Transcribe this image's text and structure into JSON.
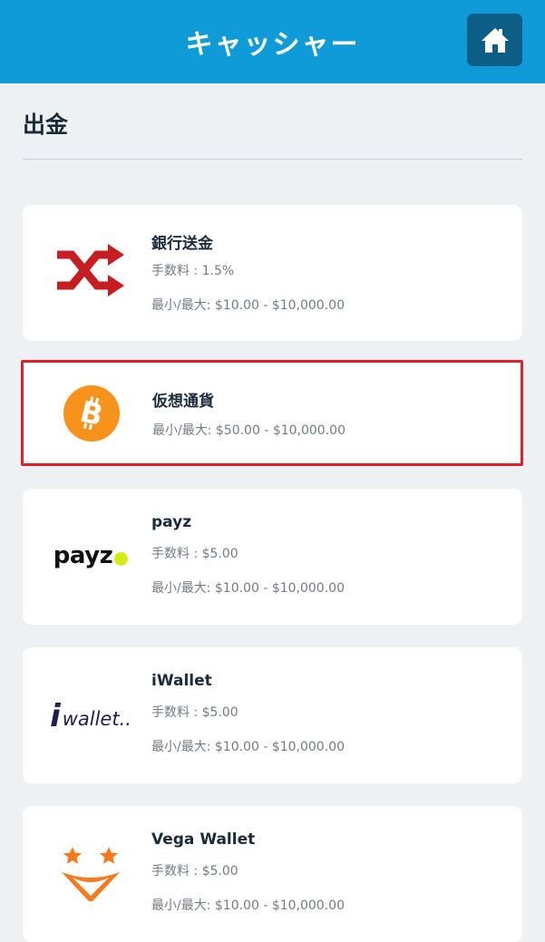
{
  "header": {
    "title": "キャッシャー"
  },
  "section": {
    "title": "出金"
  },
  "methods": [
    {
      "name": "銀行送金",
      "fee": "手数料 : 1.5%",
      "limits": "最小/最大: $10.00 - $10,000.00",
      "icon": "bank-transfer-shuffle-icon"
    },
    {
      "name": "仮想通貨",
      "limits": "最小/最大: $50.00 - $10,000.00",
      "icon": "bitcoin-icon"
    },
    {
      "name": "payz",
      "fee": "手数料 : $5.00",
      "limits": "最小/最大: $10.00 - $10,000.00",
      "logo_text": "payz",
      "icon": "payz-logo"
    },
    {
      "name": "iWallet",
      "fee": "手数料 : $5.00",
      "limits": "最小/最大: $10.00 - $10,000.00",
      "logo_i": "i",
      "logo_text": "wallet..",
      "icon": "iwallet-logo"
    },
    {
      "name": "Vega Wallet",
      "fee": "手数料 : $5.00",
      "limits": "最小/最大: $10.00 - $10,000.00",
      "icon": "vega-wallet-logo"
    }
  ],
  "colors": {
    "header_bg": "#0f9ad8",
    "home_button_bg": "#0c5e86",
    "highlight_border": "#e0202b",
    "bank_icon": "#c61d23",
    "bitcoin": "#f7931a",
    "payz_dot": "#d6ea18",
    "vega_orange": "#f47a20"
  }
}
